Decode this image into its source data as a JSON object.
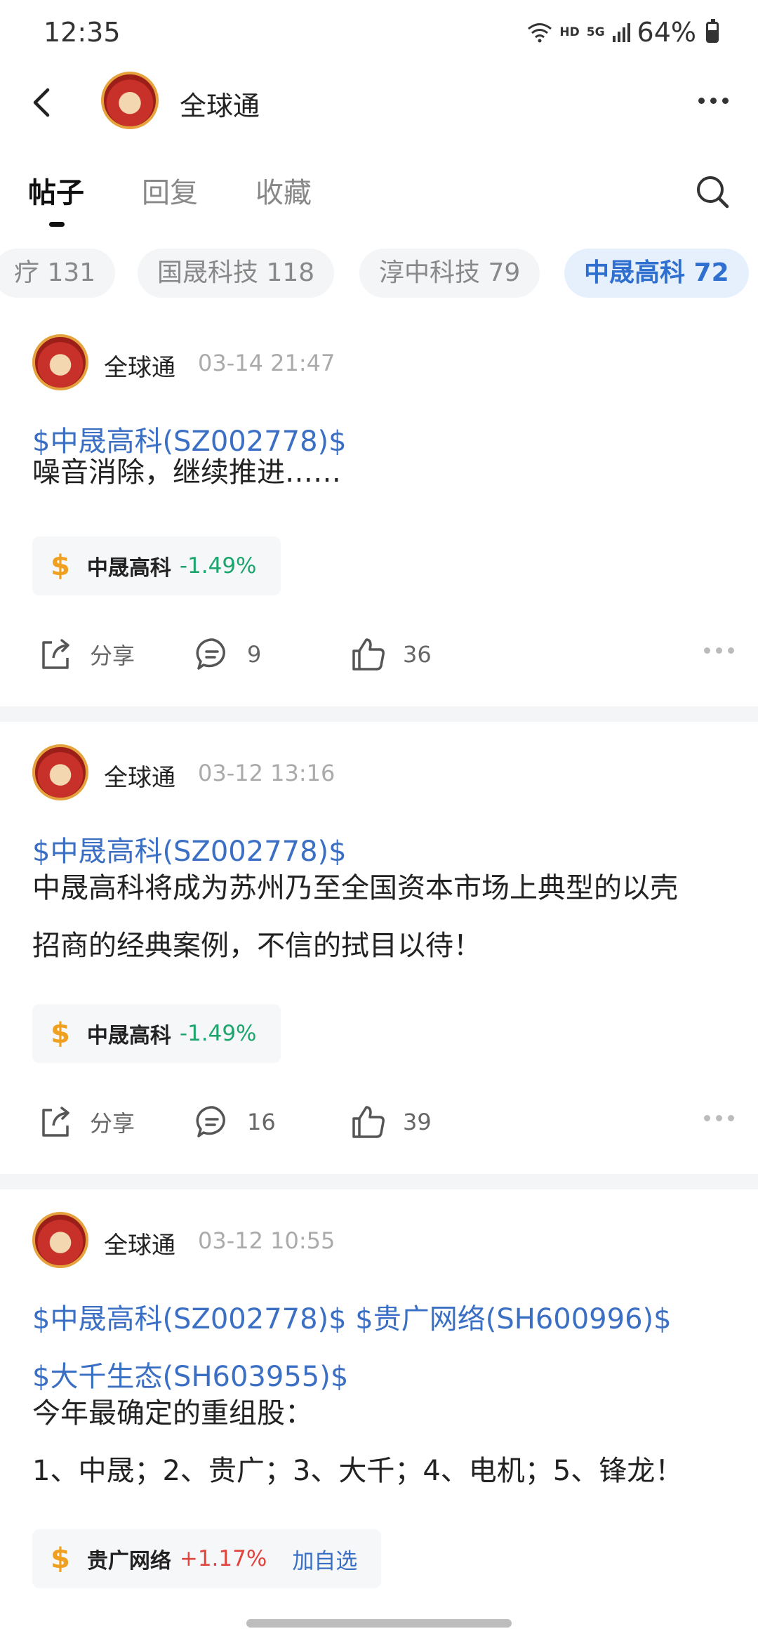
{
  "status_bar": {
    "time": "12:35",
    "network": "HD",
    "signal": "5G",
    "battery": "64%"
  },
  "header": {
    "title": "全球通"
  },
  "tabs": [
    {
      "label": "帖子",
      "active": true
    },
    {
      "label": "回复",
      "active": false
    },
    {
      "label": "收藏",
      "active": false
    }
  ],
  "chips": [
    {
      "label": "疗 131"
    },
    {
      "label": "国晟科技 118"
    },
    {
      "label": "淳中科技 79"
    },
    {
      "label": "中晟高科 72"
    }
  ],
  "posts": [
    {
      "author": "全球通",
      "time": "03-14 21:47",
      "links": "$中晟高科(SZ002778)$",
      "text": "噪音消除，继续推进……",
      "stock": {
        "name": "中晟高科",
        "change": "-1.49%"
      },
      "share_label": "分享",
      "comments": "9",
      "likes": "36"
    },
    {
      "author": "全球通",
      "time": "03-12 13:16",
      "links": "$中晟高科(SZ002778)$",
      "text_lines": [
        "中晟高科将成为苏州乃至全国资本市场上典型的以壳",
        "招商的经典案例，不信的拭目以待！"
      ],
      "stock": {
        "name": "中晟高科",
        "change": "-1.49%"
      },
      "share_label": "分享",
      "comments": "16",
      "likes": "39"
    },
    {
      "author": "全球通",
      "time": "03-12 10:55",
      "link_lines": [
        "$中晟高科(SZ002778)$ $贵广网络(SH600996)$",
        "$大千生态(SH603955)$"
      ],
      "text_lines": [
        "今年最确定的重组股：",
        "1、中晟；2、贵广；3、大千；4、电机；5、锋龙！"
      ],
      "stock": {
        "name": "贵广网络",
        "change": "+1.17%",
        "add_label": "加自选"
      }
    }
  ],
  "colors": {
    "link": "#3b6fc4",
    "down": "#1ca66e",
    "up": "#e0453d",
    "accent": "#2f6fd0"
  }
}
